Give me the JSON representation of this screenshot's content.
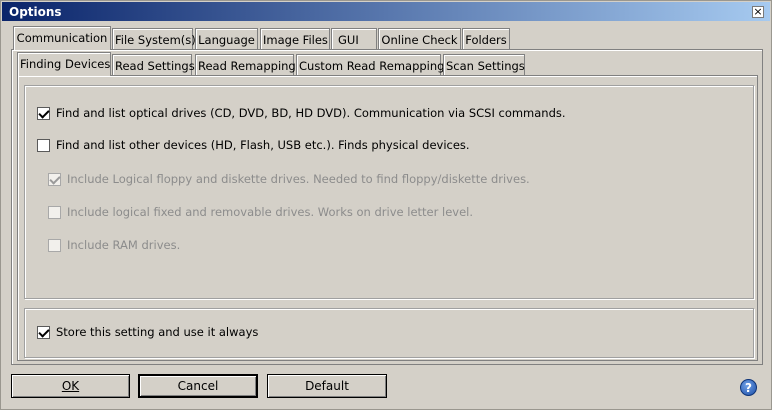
{
  "window": {
    "title": "Options",
    "close_symbol": "×"
  },
  "top_tabs": [
    {
      "label": "Communication",
      "active": true
    },
    {
      "label": "File System(s)",
      "active": false
    },
    {
      "label": "Language",
      "active": false
    },
    {
      "label": "Image Files",
      "active": false
    },
    {
      "label": "GUI",
      "active": false
    },
    {
      "label": "Online Check",
      "active": false
    },
    {
      "label": "Folders",
      "active": false
    }
  ],
  "sub_tabs": [
    {
      "label": "Finding Devices",
      "active": true
    },
    {
      "label": "Read Settings",
      "active": false
    },
    {
      "label": "Read Remapping",
      "active": false
    },
    {
      "label": "Custom Read Remapping",
      "active": false
    },
    {
      "label": "Scan Settings",
      "active": false
    }
  ],
  "options": [
    {
      "label": "Find and list optical drives (CD, DVD, BD, HD DVD).  Communication via SCSI commands.",
      "checked": true,
      "enabled": true
    },
    {
      "label": "Find and list other devices (HD, Flash, USB etc.).  Finds physical devices.",
      "checked": false,
      "enabled": true
    },
    {
      "label": "Include Logical floppy and diskette drives.  Needed to find floppy/diskette drives.",
      "checked": true,
      "enabled": false
    },
    {
      "label": "Include logical fixed and removable drives.  Works on drive letter level.",
      "checked": false,
      "enabled": false
    },
    {
      "label": "Include RAM drives.",
      "checked": false,
      "enabled": false
    }
  ],
  "store_setting": {
    "label": "Store this setting and use it always",
    "checked": true
  },
  "buttons": {
    "ok": "OK",
    "cancel": "Cancel",
    "default": "Default"
  },
  "help": {
    "symbol": "?"
  }
}
